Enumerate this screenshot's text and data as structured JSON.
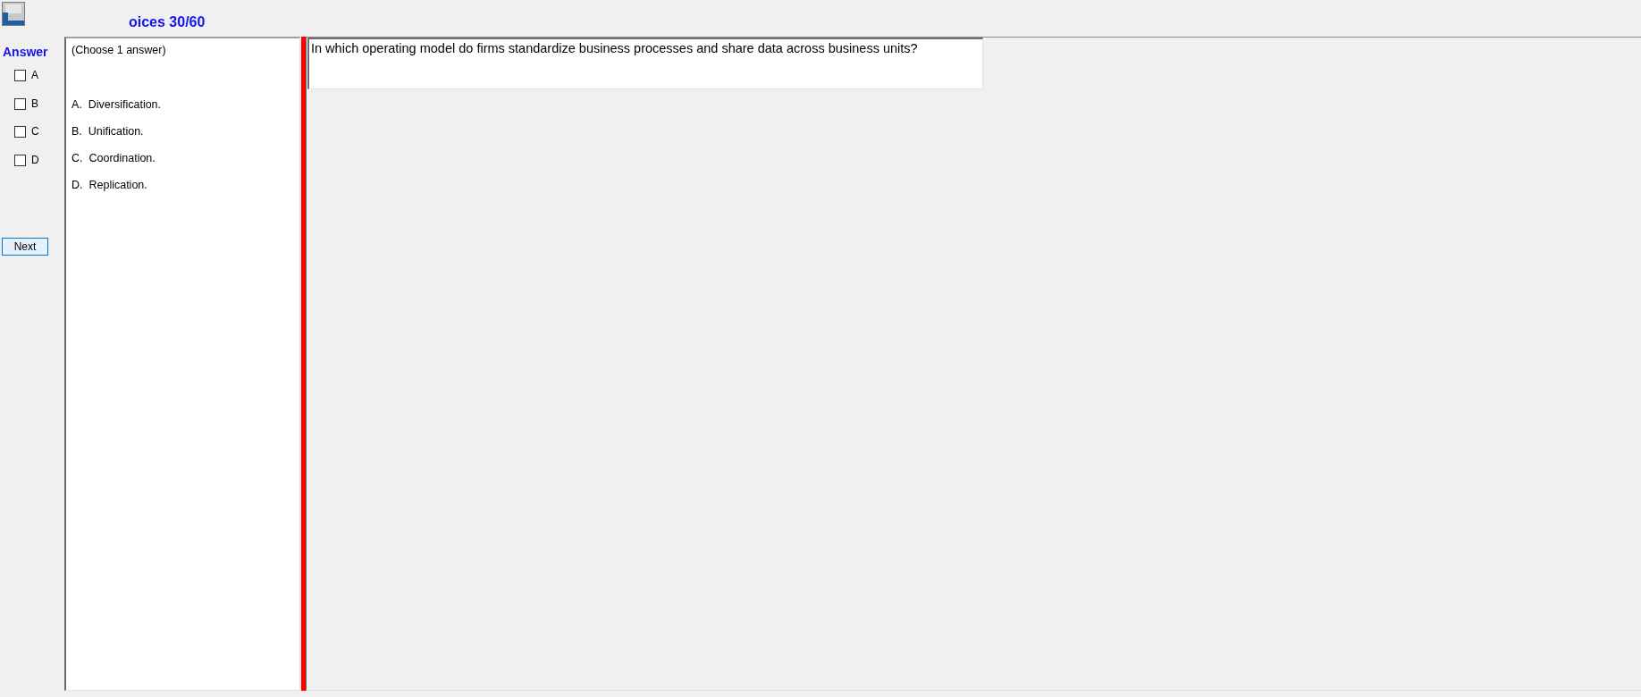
{
  "header": {
    "title": "oices 30/60"
  },
  "answer_panel": {
    "heading": "Answer",
    "choices": [
      {
        "label": "A",
        "checked": false
      },
      {
        "label": "B",
        "checked": false
      },
      {
        "label": "C",
        "checked": false
      },
      {
        "label": "D",
        "checked": false
      }
    ],
    "next_button": "Next"
  },
  "options_panel": {
    "instruction": "(Choose 1 answer)",
    "options": [
      {
        "text": "A.  Diversification."
      },
      {
        "text": "B.  Unification."
      },
      {
        "text": "C.  Coordination."
      },
      {
        "text": "D.  Replication."
      }
    ]
  },
  "question": {
    "text": "In which operating model do firms standardize business processes and share data across business units?"
  }
}
